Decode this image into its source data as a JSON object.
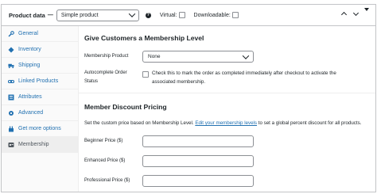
{
  "header": {
    "title": "Product data",
    "separator": "—",
    "product_type": "Simple product",
    "virtual_label": "Virtual:",
    "downloadable_label": "Downloadable:"
  },
  "sidebar": {
    "items": [
      {
        "label": "General",
        "icon": "wrench-icon"
      },
      {
        "label": "Inventory",
        "icon": "diamond-icon"
      },
      {
        "label": "Shipping",
        "icon": "truck-icon"
      },
      {
        "label": "Linked Products",
        "icon": "link-icon"
      },
      {
        "label": "Attributes",
        "icon": "list-icon"
      },
      {
        "label": "Advanced",
        "icon": "gear-icon"
      },
      {
        "label": "Get more options",
        "icon": "plugin-icon"
      },
      {
        "label": "Membership",
        "icon": "membership-icon"
      }
    ],
    "active": "Membership"
  },
  "membership_section": {
    "heading": "Give Customers a Membership Level",
    "product_label": "Membership Product",
    "product_value": "None",
    "autocomplete_label_line1": "Autocomplete Order",
    "autocomplete_label_line2": "Status",
    "autocomplete_desc_line1": "Check this to mark the order as completed immediately after checkout to activate the",
    "autocomplete_desc_line2": "associated membership."
  },
  "discount_section": {
    "heading": "Member Discount Pricing",
    "intro_before": "Set the custom price based on Membership Level.",
    "intro_link": "Edit your membership levels",
    "intro_after": "to set a global percent discount for all products.",
    "fields": [
      {
        "label": "Beginner Price ($)",
        "value": ""
      },
      {
        "label": "Enhanced Price ($)",
        "value": ""
      },
      {
        "label": "Professional Price ($)",
        "value": ""
      }
    ]
  }
}
